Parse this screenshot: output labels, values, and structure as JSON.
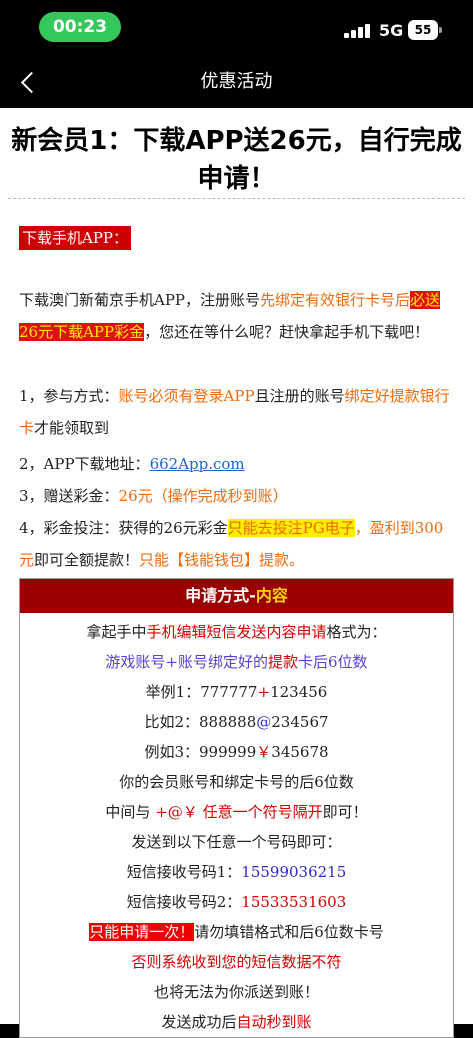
{
  "status": {
    "time": "00:23",
    "network": "5G",
    "battery": "55"
  },
  "nav": {
    "title": "优惠活动"
  },
  "page": {
    "title": "新会员1：下载APP送26元，自行完成申请！",
    "section_label": "下载手机APP：",
    "intro": {
      "t1": "下载澳门新葡京手机APP，注册账号",
      "o1": "先绑定有效银行卡号后",
      "hl": "必送26元下载APP彩金",
      "t2": "，您还在等什么呢？赶快拿起手机下载吧！"
    },
    "item1": {
      "prefix": "1，参与方式：",
      "o1": "账号必须有登录APP",
      "t1": "且注册的账号",
      "o2": "绑定好提款银行卡",
      "t2": "才能领取到"
    },
    "item2": {
      "prefix": "2，APP下载地址：",
      "link": "662App.com"
    },
    "item3": {
      "prefix": "3，赠送彩金：",
      "o1": "26元（操作完成秒到账）"
    },
    "item4": {
      "prefix": "4，彩金投注：获得的26元彩金",
      "hl": "只能去投注PG电子",
      "o1": "，盈利到300元",
      "t1": "即可全额提款！",
      "o2": "只能【钱能钱包】提款。"
    }
  },
  "apply": {
    "header_a": "申请方式-",
    "header_b": "内容",
    "l1a": "拿起手中",
    "l1b": "手机编辑短信发送内容申请",
    "l1c": "格式为：",
    "l2a": "游戏账号+账号绑定好的",
    "l2b": "提款",
    "l2c": "卡后6位数",
    "l3a": "举例1：777777",
    "l3b": "+",
    "l3c": "123456",
    "l4a": "比如2：888888",
    "l4b": "@",
    "l4c": "234567",
    "l5a": "例如3：999999",
    "l5b": "￥",
    "l5c": "345678",
    "l6": "你的会员账号和绑定卡号的后6位数",
    "l7a": "中间与",
    "l7b": "+@￥",
    "l7c": "任意一个符号隔开",
    "l7d": "即可！",
    "l8": "发送到以下任意一个号码即可：",
    "l9a": "短信接收号码1：",
    "l9b": "15599036215",
    "l10a": "短信接收号码2：",
    "l10b": "15533531603",
    "l11a": "只能申请一次！",
    "l11b": "请勿填错格式和后6位数卡号",
    "l12": "否则系统收到您的短信数据不符",
    "l13": "也将无法为你派送到账！",
    "l14a": "发送成功后",
    "l14b": "自动秒到账"
  }
}
